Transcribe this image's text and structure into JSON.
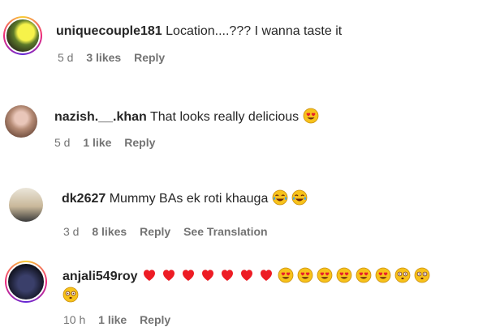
{
  "comments": [
    {
      "username": "uniquecouple181",
      "text": "Location....??? I wanna taste it",
      "time": "5 d",
      "likes": "3 likes",
      "reply": "Reply"
    },
    {
      "username": "nazish.__.khan",
      "text": "That looks really delicious",
      "time": "5 d",
      "likes": "1 like",
      "reply": "Reply",
      "emoji": [
        "heart-eyes-emoji"
      ]
    },
    {
      "username": "dk2627",
      "text": "Mummy BAs ek roti khauga",
      "time": "3 d",
      "likes": "8 likes",
      "reply": "Reply",
      "see_translation": "See Translation",
      "emoji": [
        "tears-of-joy-emoji",
        "tears-of-joy-emoji"
      ]
    },
    {
      "username": "anjali549roy",
      "text": "",
      "time": "10 h",
      "likes": "1 like",
      "reply": "Reply",
      "emoji": [
        "red-heart-emoji x7",
        "heart-eyes-emoji x7",
        "flushed-emoji x3"
      ]
    }
  ],
  "colors": {
    "text": "#262626",
    "meta": "#737373",
    "heart": "#ed1c24",
    "emoji_yellow": "#f7c21b"
  }
}
